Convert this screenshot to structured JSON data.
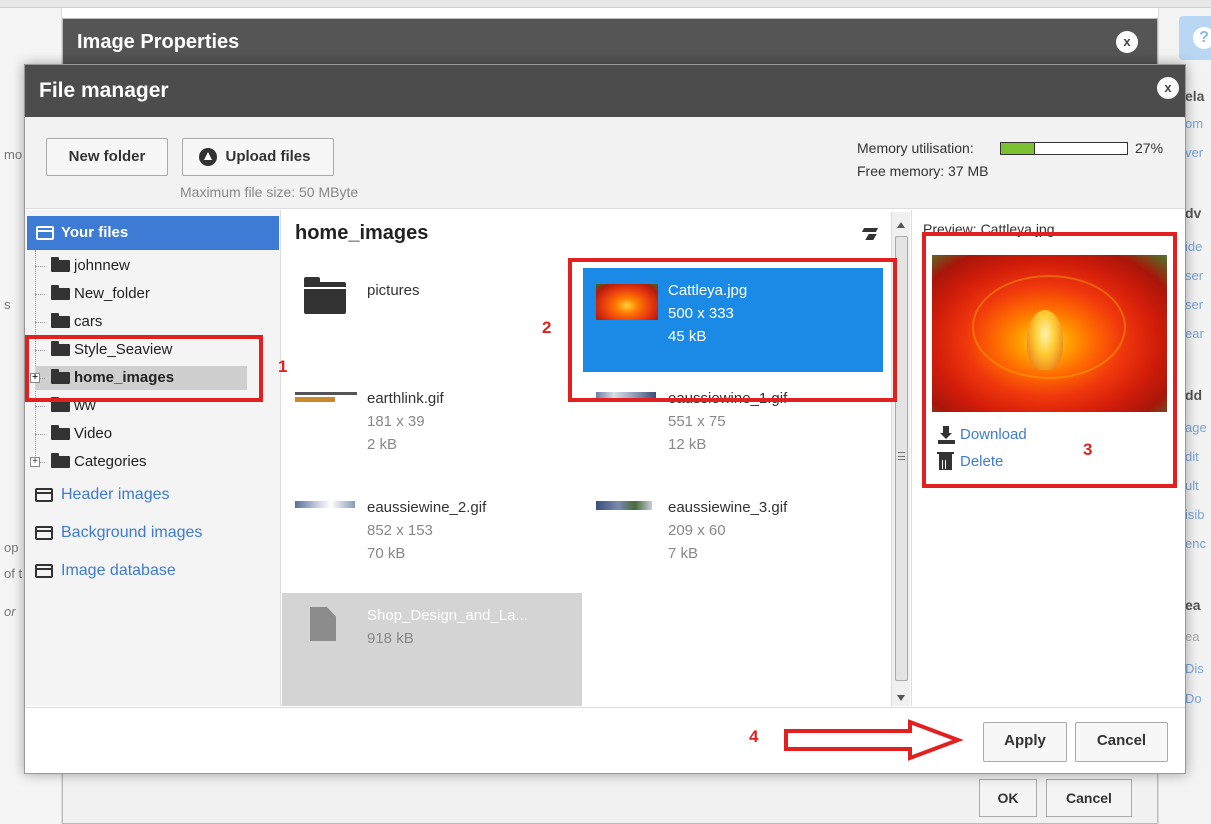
{
  "background": {
    "left_fragments": [
      "mo",
      "s",
      "op",
      "of t",
      "or"
    ],
    "right_fragments": [
      {
        "text": "ela",
        "kind": "heading"
      },
      {
        "text": "om",
        "kind": "link"
      },
      {
        "text": "ver",
        "kind": "link"
      },
      {
        "text": "dv",
        "kind": "heading"
      },
      {
        "text": "ide",
        "kind": "link"
      },
      {
        "text": "ser",
        "kind": "link"
      },
      {
        "text": "ser",
        "kind": "link"
      },
      {
        "text": "ear",
        "kind": "link"
      },
      {
        "text": "dd",
        "kind": "heading"
      },
      {
        "text": "age",
        "kind": "link"
      },
      {
        "text": "dit",
        "kind": "link"
      },
      {
        "text": "ult",
        "kind": "link"
      },
      {
        "text": "isib",
        "kind": "link"
      },
      {
        "text": "enc",
        "kind": "link"
      },
      {
        "text": "ea",
        "kind": "heading"
      },
      {
        "text": "ea",
        "kind": "link"
      },
      {
        "text": "Dis",
        "kind": "link"
      },
      {
        "text": "Do",
        "kind": "link"
      }
    ],
    "help_icon": "?",
    "image_properties": {
      "title": "Image Properties",
      "close_icon": "x",
      "ok_label": "OK",
      "cancel_label": "Cancel"
    }
  },
  "file_manager": {
    "title": "File manager",
    "close_icon": "x",
    "toolbar": {
      "new_folder_label": "New folder",
      "upload_label": "Upload files",
      "max_file_size": "Maximum file size: 50 MByte"
    },
    "memory": {
      "label": "Memory utilisation:",
      "percent_text": "27%",
      "fraction": 0.27,
      "free_text": "Free memory: 37 MB",
      "fill_color": "#7cc032"
    },
    "sidebar": {
      "root_label": "Your files",
      "tree": [
        {
          "label": "johnnew",
          "selected": false,
          "expander": false
        },
        {
          "label": "New_folder",
          "selected": false,
          "expander": false
        },
        {
          "label": "cars",
          "selected": false,
          "expander": false
        },
        {
          "label": "Style_Seaview",
          "selected": false,
          "expander": false
        },
        {
          "label": "home_images",
          "selected": true,
          "expander": true
        },
        {
          "label": "ww",
          "selected": false,
          "expander": false
        },
        {
          "label": "Video",
          "selected": false,
          "expander": false
        },
        {
          "label": "Categories",
          "selected": false,
          "expander": true
        }
      ],
      "links": [
        "Header images",
        "Background images",
        "Image database"
      ]
    },
    "main": {
      "folder_title": "home_images",
      "items": [
        {
          "name": "pictures",
          "dims": "",
          "size": "",
          "kind": "folder"
        },
        {
          "name": "Cattleya.jpg",
          "dims": "500 x 333",
          "size": "45 kB",
          "kind": "image",
          "selected": true
        },
        {
          "name": "earthlink.gif",
          "dims": "181 x 39",
          "size": "2 kB",
          "kind": "image"
        },
        {
          "name": "eaussiewine_1.gif",
          "dims": "551 x 75",
          "size": "12 kB",
          "kind": "image"
        },
        {
          "name": "eaussiewine_2.gif",
          "dims": "852 x 153",
          "size": "70 kB",
          "kind": "image"
        },
        {
          "name": "eaussiewine_3.gif",
          "dims": "209 x 60",
          "size": "7 kB",
          "kind": "image"
        },
        {
          "name": "Shop_Design_and_La...",
          "dims": "",
          "size": "918 kB",
          "kind": "document"
        }
      ]
    },
    "preview": {
      "label": "Preview: Cattleya.jpg",
      "download_label": "Download",
      "delete_label": "Delete"
    },
    "footer": {
      "apply_label": "Apply",
      "cancel_label": "Cancel"
    }
  },
  "annotations": {
    "numbers": [
      "1",
      "2",
      "3",
      "4"
    ],
    "color": "#e32020"
  }
}
